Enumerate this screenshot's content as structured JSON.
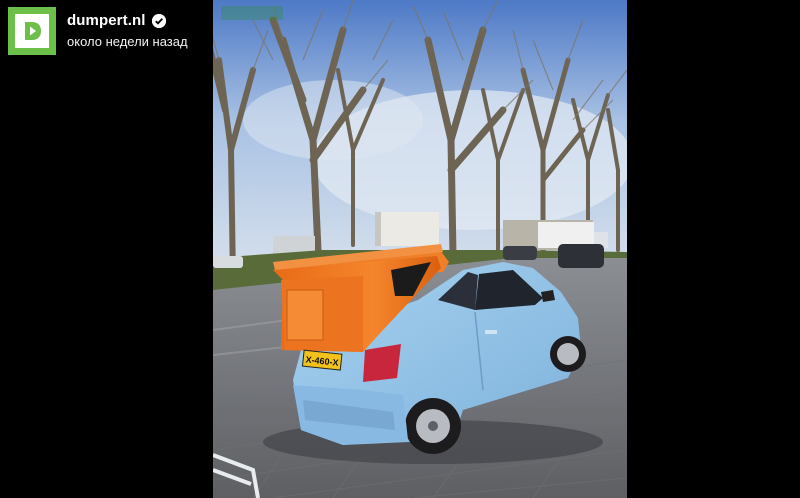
{
  "channel": {
    "name": "dumpert.nl",
    "posted": "около недели назад",
    "logo_letter": "D",
    "logo_color": "#6cc04a",
    "verified_icon": "verified-check-icon"
  },
  "video": {
    "plate": "X-460-X",
    "overlay_icon": "dumpert-watermark"
  },
  "colors": {
    "background": "#000000",
    "car_body": "#8fc0e6",
    "bin": "#f07a22"
  }
}
